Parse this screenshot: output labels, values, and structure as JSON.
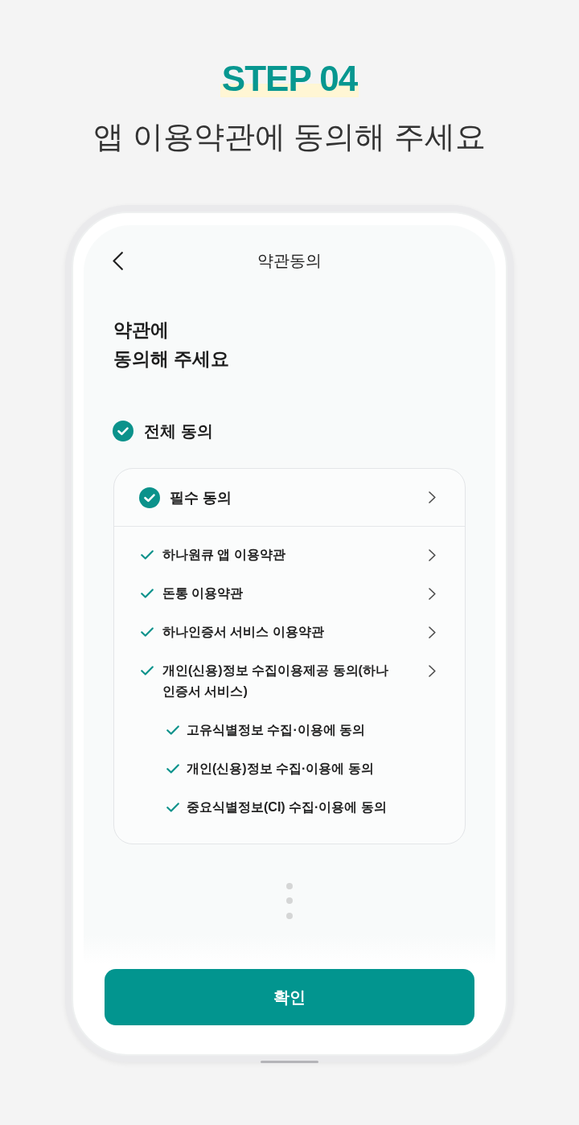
{
  "header": {
    "step": "STEP 04",
    "title": "앱 이용약관에 동의해 주세요"
  },
  "screen": {
    "nav": {
      "title": "약관동의"
    },
    "heading": "약관에\n동의해 주세요",
    "agree_all": {
      "label": "전체 동의",
      "checked": true
    },
    "required": {
      "label": "필수 동의",
      "checked": true,
      "items": [
        {
          "label": "하나원큐 앱 이용약관",
          "checked": true
        },
        {
          "label": "돈통 이용약관",
          "checked": true
        },
        {
          "label": "하나인증서 서비스 이용약관",
          "checked": true
        },
        {
          "label": "개인(신용)정보 수집이용제공 동의(하나 인증서 서비스)",
          "checked": true,
          "children": [
            {
              "label": "고유식별정보 수집·이용에 동의",
              "checked": true
            },
            {
              "label": "개인(신용)정보 수집·이용에 동의",
              "checked": true
            },
            {
              "label": "중요식별정보(CI) 수집·이용에 동의",
              "checked": true
            }
          ]
        }
      ]
    },
    "confirm_button": "확인"
  }
}
